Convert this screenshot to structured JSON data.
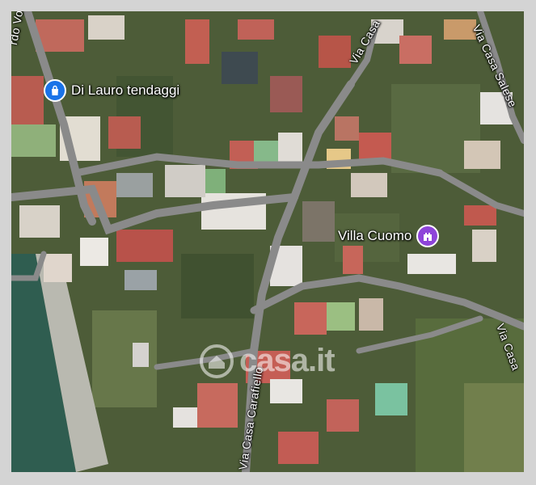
{
  "map": {
    "streets": {
      "volta": "rdo Volta",
      "via_casa_1": "Via Casa",
      "via_casa_salese": "Via Casa Salese",
      "via_casa_carafiello": "Via Casa Carafiello",
      "via_casa_2": "Via Casa"
    },
    "pois": [
      {
        "name": "Di Lauro tendaggi",
        "icon": "shopping-bag-icon",
        "color": "#1a73e8"
      },
      {
        "name": "Villa Cuomo",
        "icon": "castle-icon",
        "color": "#8e44d9"
      }
    ],
    "watermark_text": "casa.it",
    "colors": {
      "frame": "#d4d4d4",
      "sea": "#2f5d50",
      "road": "#8a8a8a"
    }
  }
}
